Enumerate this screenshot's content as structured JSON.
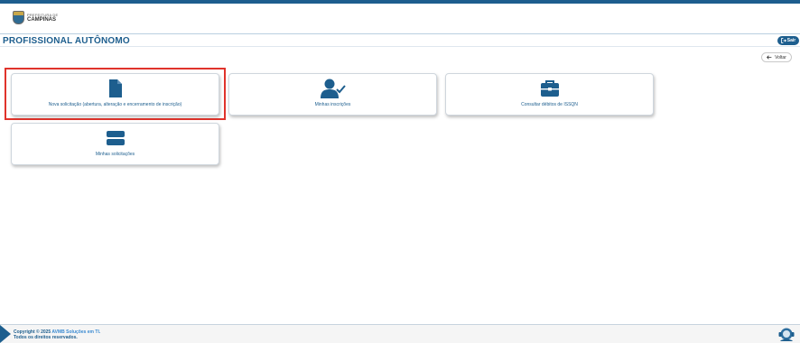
{
  "header": {
    "logo_small": "PREFEITURA DE",
    "logo_big": "CAMPINAS"
  },
  "title_bar": {
    "title": "PROFISSIONAL AUTÔNOMO",
    "logout_label": "Sair",
    "logout_icon": "logout-icon"
  },
  "back_button": {
    "label": "Voltar",
    "icon": "arrow-left-icon"
  },
  "cards": [
    {
      "label": "Nova solicitação (abertura, alteração e encerramento de inscrição)",
      "icon": "document-icon",
      "highlighted": true
    },
    {
      "label": "Minhas inscrições",
      "icon": "user-check-icon"
    },
    {
      "label": "Consultar débitos de ISSQN",
      "icon": "briefcase-icon"
    },
    {
      "label": "Minhas solicitações",
      "icon": "server-icon"
    }
  ],
  "footer": {
    "copyright_prefix": "Copyright © 2025",
    "brand": "AVMB Soluções em TI.",
    "rights": "Todos os direitos reservados.",
    "help_icon": "support-agent-icon"
  },
  "colors": {
    "primary": "#1d5e8e",
    "highlight_border": "#e0332b",
    "footer_bg": "#f5f5f5"
  }
}
